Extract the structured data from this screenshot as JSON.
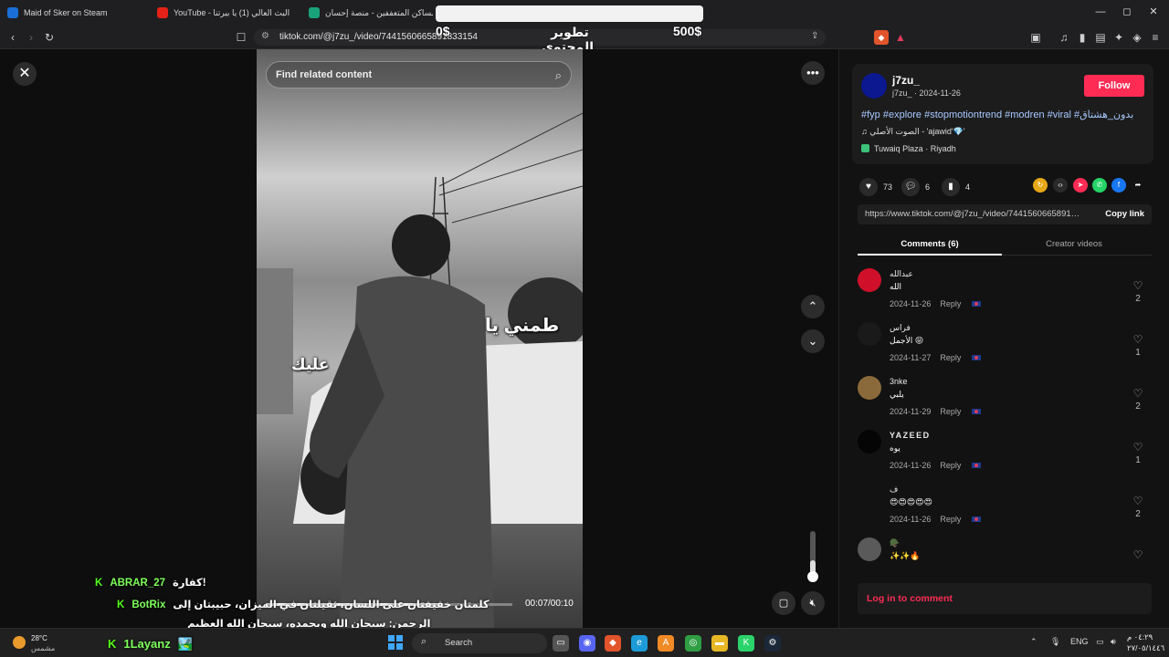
{
  "tabs": [
    {
      "label": "Maid of Sker on Steam",
      "color": "#1b6fd6"
    },
    {
      "label": "YouTube - البث العالي (1) يا بيرتنا",
      "color": "#e62117"
    },
    {
      "label": "مساكن المتعففين - منصة إحسان",
      "color": "#1aa37a"
    }
  ],
  "window": {
    "minimize": "—",
    "maximize": "◻",
    "close": "✕"
  },
  "browser": {
    "url": "tiktok.com/@j7zu_/video/7441560665891833154"
  },
  "stream_overlay": {
    "amount_left": "0$",
    "amount_right": "500$",
    "goal_text": "تطوير المحتوى والمايك"
  },
  "video": {
    "search_placeholder": "Find related content",
    "overlay_text_1": "طمني يا",
    "overlay_text_2": "عليك",
    "time": "00:07/00:10",
    "progress": 0.7
  },
  "author": {
    "name": "j7zu_",
    "handle_date": "j7zu_ · 2024-11-26",
    "follow": "Follow",
    "avatar_color": "#0b1890"
  },
  "caption": {
    "hashtags": "#fyp #explore #stopmotiontrend #modren #viral #بدون_هشتاق",
    "music": "الصوت الأصلي - 'ajawid'💎'",
    "location": "Tuwaiq Plaza · Riyadh"
  },
  "stats": {
    "likes": "73",
    "comments": "6",
    "saves": "4"
  },
  "copy": {
    "url": "https://www.tiktok.com/@j7zu_/video/7441560665891833154",
    "button": "Copy link"
  },
  "panel_tabs": {
    "comments": "Comments (6)",
    "creator": "Creator videos"
  },
  "comments": [
    {
      "name": "عبدالله",
      "text": "الله",
      "date": "2024-11-26",
      "reply": "Reply",
      "likes": "2",
      "avatar": "#d0102a"
    },
    {
      "name": "فراس",
      "text": "الأجمل 😝",
      "date": "2024-11-27",
      "reply": "Reply",
      "likes": "1",
      "avatar": "#1a1a1a"
    },
    {
      "name": "3nke",
      "text": "يلبي",
      "date": "2024-11-29",
      "reply": "Reply",
      "likes": "2",
      "avatar": "#8a6a3a"
    },
    {
      "name": "YAZEED",
      "text": "يوه",
      "date": "2024-11-26",
      "reply": "Reply",
      "likes": "1",
      "avatar": "#050505"
    },
    {
      "name": "ف",
      "text": "😍😍😍😍😍",
      "date": "2024-11-26",
      "reply": "Reply",
      "likes": "2",
      "avatar": "#121212"
    },
    {
      "name": "🪖",
      "text": "✨✨🔥",
      "date": "",
      "reply": "",
      "likes": "",
      "avatar": "#5a5a5a"
    }
  ],
  "login": "Log in to comment",
  "chat": [
    {
      "name": "ABRAR_27",
      "message": "كفارة!"
    },
    {
      "name": "BotRix",
      "message": "كلمتان خفيفتان على اللسان، ثقيلتان في الميزان، حبيبتان إلى"
    },
    {
      "name": "",
      "message": "الرحمن: سبحان الله وبحمده، سبحان الله العظيم"
    },
    {
      "name": "1Layanz",
      "message": "🏞️"
    }
  ],
  "taskbar": {
    "temp": "28°C",
    "weather": "مشمس",
    "search": "Search",
    "lang": "ENG",
    "time": "٠٤:٢٩ م",
    "date": "٢٧/٠٥/١٤٤٦"
  }
}
